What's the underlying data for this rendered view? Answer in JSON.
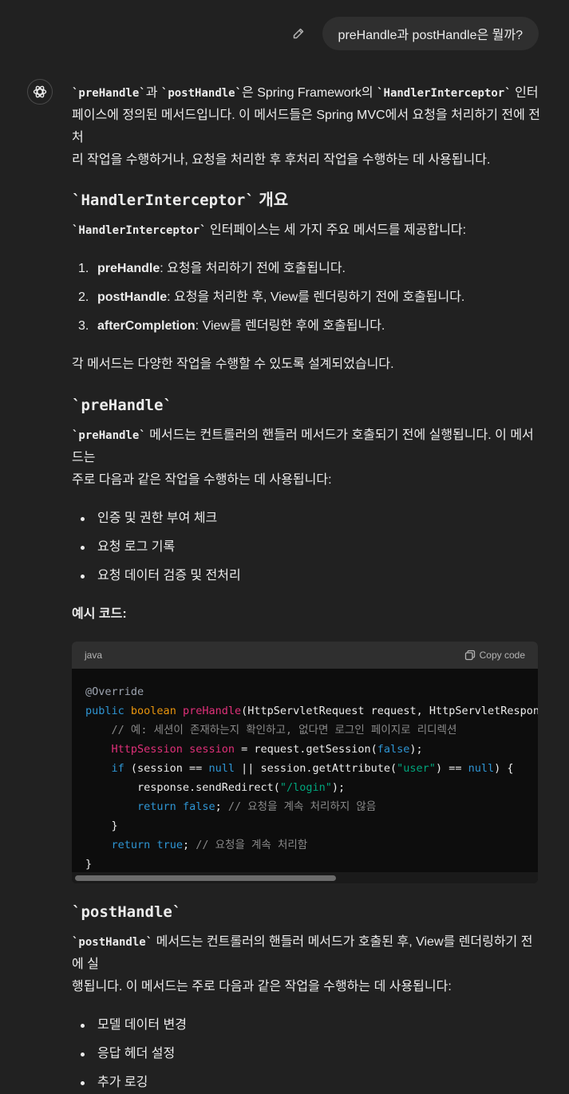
{
  "user_message": "preHandle과 postHandle은 뭘까?",
  "intro": {
    "c1": "`preHandle`",
    "t1": "과 ",
    "c2": "`postHandle`",
    "t2": "은 Spring Framework의 ",
    "c3": "`HandlerInterceptor`",
    "t3": " 인터",
    "line2": "페이스에 정의된 메서드입니다. 이 메서드들은 Spring MVC에서 요청을 처리하기 전에 전처",
    "line3": "리 작업을 수행하거나, 요청을 처리한 후 후처리 작업을 수행하는 데 사용됩니다."
  },
  "section1": {
    "heading_code": "`HandlerInterceptor`",
    "heading_text": " 개요",
    "desc_code": "`HandlerInterceptor`",
    "desc_text": " 인터페이스는 세 가지 주요 메서드를 제공합니다:",
    "items": [
      {
        "num": "1.",
        "name": "preHandle",
        "text": ": 요청을 처리하기 전에 호출됩니다."
      },
      {
        "num": "2.",
        "name": "postHandle",
        "text": ": 요청을 처리한 후, View를 렌더링하기 전에 호출됩니다."
      },
      {
        "num": "3.",
        "name": "afterCompletion",
        "text": ": View를 렌더링한 후에 호출됩니다."
      }
    ],
    "summary": "각 메서드는 다양한 작업을 수행할 수 있도록 설계되었습니다."
  },
  "section2": {
    "heading": "`preHandle`",
    "desc_code": "`preHandle`",
    "desc_text1": " 메서드는 컨트롤러의 핸들러 메서드가 호출되기 전에 실행됩니다. 이 메서드는",
    "desc_text2": "주로 다음과 같은 작업을 수행하는 데 사용됩니다:",
    "bullets": [
      "인증 및 권한 부여 체크",
      "요청 로그 기록",
      "요청 데이터 검증 및 전처리"
    ],
    "example_label": "예시 코드:"
  },
  "codeblock": {
    "language": "java",
    "copy_label": "Copy code",
    "lines": [
      {
        "indent": "",
        "tokens": [
          {
            "c": "#9ca3af",
            "t": "@Override"
          }
        ]
      },
      {
        "indent": "",
        "tokens": [
          {
            "c": "#2e95d3",
            "t": "public"
          },
          {
            "c": "#ececec",
            "t": " "
          },
          {
            "c": "#e9950c",
            "t": "boolean"
          },
          {
            "c": "#ececec",
            "t": " "
          },
          {
            "c": "#df3079",
            "t": "preHandle"
          },
          {
            "c": "#ececec",
            "t": "(HttpServletRequest request, HttpServletResponse response, Object handler)"
          }
        ]
      },
      {
        "indent": "    ",
        "tokens": [
          {
            "c": "#8a8a8a",
            "t": "// 예: 세션이 존재하는지 확인하고, 없다면 로그인 페이지로 리디렉션"
          }
        ]
      },
      {
        "indent": "    ",
        "tokens": [
          {
            "c": "#df3079",
            "t": "HttpSession"
          },
          {
            "c": "#ececec",
            "t": " "
          },
          {
            "c": "#df3079",
            "t": "session"
          },
          {
            "c": "#ececec",
            "t": " = request.getSession("
          },
          {
            "c": "#2e95d3",
            "t": "false"
          },
          {
            "c": "#ececec",
            "t": ");"
          }
        ]
      },
      {
        "indent": "    ",
        "tokens": [
          {
            "c": "#2e95d3",
            "t": "if"
          },
          {
            "c": "#ececec",
            "t": " (session == "
          },
          {
            "c": "#2e95d3",
            "t": "null"
          },
          {
            "c": "#ececec",
            "t": " || session.getAttribute("
          },
          {
            "c": "#00a67d",
            "t": "\"user\""
          },
          {
            "c": "#ececec",
            "t": ") == "
          },
          {
            "c": "#2e95d3",
            "t": "null"
          },
          {
            "c": "#ececec",
            "t": ") {"
          }
        ]
      },
      {
        "indent": "        ",
        "tokens": [
          {
            "c": "#ececec",
            "t": "response.sendRedirect("
          },
          {
            "c": "#00a67d",
            "t": "\"/login\""
          },
          {
            "c": "#ececec",
            "t": ");"
          }
        ]
      },
      {
        "indent": "        ",
        "tokens": [
          {
            "c": "#2e95d3",
            "t": "return"
          },
          {
            "c": "#ececec",
            "t": " "
          },
          {
            "c": "#2e95d3",
            "t": "false"
          },
          {
            "c": "#ececec",
            "t": "; "
          },
          {
            "c": "#8a8a8a",
            "t": "// 요청을 계속 처리하지 않음"
          }
        ]
      },
      {
        "indent": "    ",
        "tokens": [
          {
            "c": "#ececec",
            "t": "}"
          }
        ]
      },
      {
        "indent": "    ",
        "tokens": [
          {
            "c": "#2e95d3",
            "t": "return"
          },
          {
            "c": "#ececec",
            "t": " "
          },
          {
            "c": "#2e95d3",
            "t": "true"
          },
          {
            "c": "#ececec",
            "t": "; "
          },
          {
            "c": "#8a8a8a",
            "t": "// 요청을 계속 처리함"
          }
        ]
      },
      {
        "indent": "",
        "tokens": [
          {
            "c": "#ececec",
            "t": "}"
          }
        ]
      }
    ]
  },
  "section3": {
    "heading": "`postHandle`",
    "desc_code": "`postHandle`",
    "desc_text1": " 메서드는 컨트롤러의 핸들러 메서드가 호출된 후, View를 렌더링하기 전에 실",
    "desc_text2": "행됩니다. 이 메서드는 주로 다음과 같은 작업을 수행하는 데 사용됩니다:",
    "bullets": [
      "모델 데이터 변경",
      "응답 헤더 설정",
      "추가 로깅"
    ]
  }
}
